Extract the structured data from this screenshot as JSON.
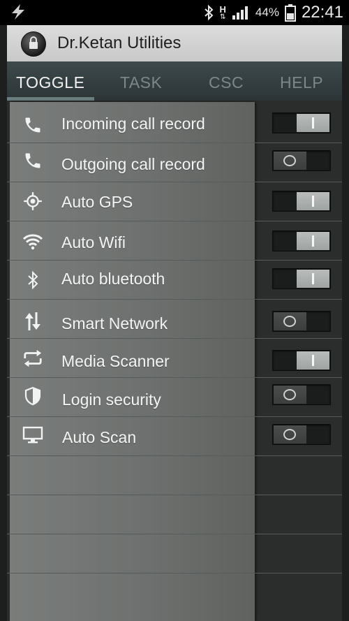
{
  "status_bar": {
    "network_type": "H",
    "battery_percent": "44%",
    "time": "22:41"
  },
  "app": {
    "title": "Dr.Ketan Utilities"
  },
  "tabs": [
    {
      "label": "TOGGLE",
      "active": true
    },
    {
      "label": "TASK",
      "active": false
    },
    {
      "label": "CSC",
      "active": false
    },
    {
      "label": "HELP",
      "active": false
    }
  ],
  "settings": [
    {
      "label": "Incoming call record",
      "icon": "phone-icon",
      "enabled": true
    },
    {
      "label": "Outgoing call record",
      "icon": "phone-icon",
      "enabled": false
    },
    {
      "label": "Auto GPS",
      "icon": "gps-icon",
      "enabled": true
    },
    {
      "label": "Auto Wifi",
      "icon": "wifi-icon",
      "enabled": true
    },
    {
      "label": "Auto bluetooth",
      "icon": "bluetooth-icon",
      "enabled": true
    },
    {
      "label": "Smart Network",
      "icon": "data-arrows-icon",
      "enabled": false
    },
    {
      "label": "Media Scanner",
      "icon": "sync-arrows-icon",
      "enabled": true
    },
    {
      "label": "Login security",
      "icon": "shield-icon",
      "enabled": false
    },
    {
      "label": "Auto Scan",
      "icon": "monitor-icon",
      "enabled": false
    }
  ]
}
